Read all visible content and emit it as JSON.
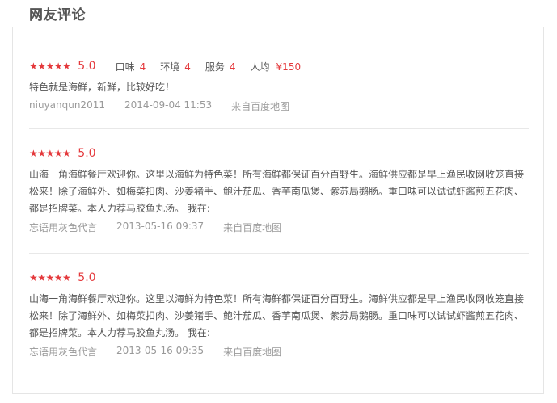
{
  "section_title": "网友评论",
  "reviews": [
    {
      "stars": "★★★★★",
      "score": "5.0",
      "taste_label": "口味",
      "taste": "4",
      "env_label": "环境",
      "env": "4",
      "service_label": "服务",
      "service": "4",
      "price_label": "人均",
      "price": "¥150",
      "text": "特色就是海鲜，新鲜，比较好吃！",
      "user": "niuyanqun2011",
      "time": "2014-09-04 11:53",
      "source": "来自百度地图"
    },
    {
      "stars": "★★★★★",
      "score": "5.0",
      "text": "山海一角海鲜餐厅欢迎你。这里以海鲜为特色菜！所有海鲜都保证百分百野生。海鲜供应都是早上渔民收网收笼直接松来！除了海鲜外、如梅菜扣肉、沙姜猪手、鲍汁茄瓜、香芋南瓜煲、紫苏局鹅肠。重口味可以试试虾酱煎五花肉、都是招牌菜。本人力荐马胶鱼丸汤。 我在:",
      "user": "忘语用灰色代言",
      "time": "2013-05-16 09:37",
      "source": "来自百度地图"
    },
    {
      "stars": "★★★★★",
      "score": "5.0",
      "text": "山海一角海鲜餐厅欢迎你。这里以海鲜为特色菜！所有海鲜都保证百分百野生。海鲜供应都是早上渔民收网收笼直接松来！除了海鲜外、如梅菜扣肉、沙姜猪手、鲍汁茄瓜、香芋南瓜煲、紫苏局鹅肠。重口味可以试试虾酱煎五花肉、都是招牌菜。本人力荐马胶鱼丸汤。 我在:",
      "user": "忘语用灰色代言",
      "time": "2013-05-16 09:35",
      "source": "来自百度地图"
    }
  ],
  "colors": {
    "accent": "#e4393c",
    "text": "#555555",
    "muted": "#999999",
    "border": "#e5e5e5"
  }
}
